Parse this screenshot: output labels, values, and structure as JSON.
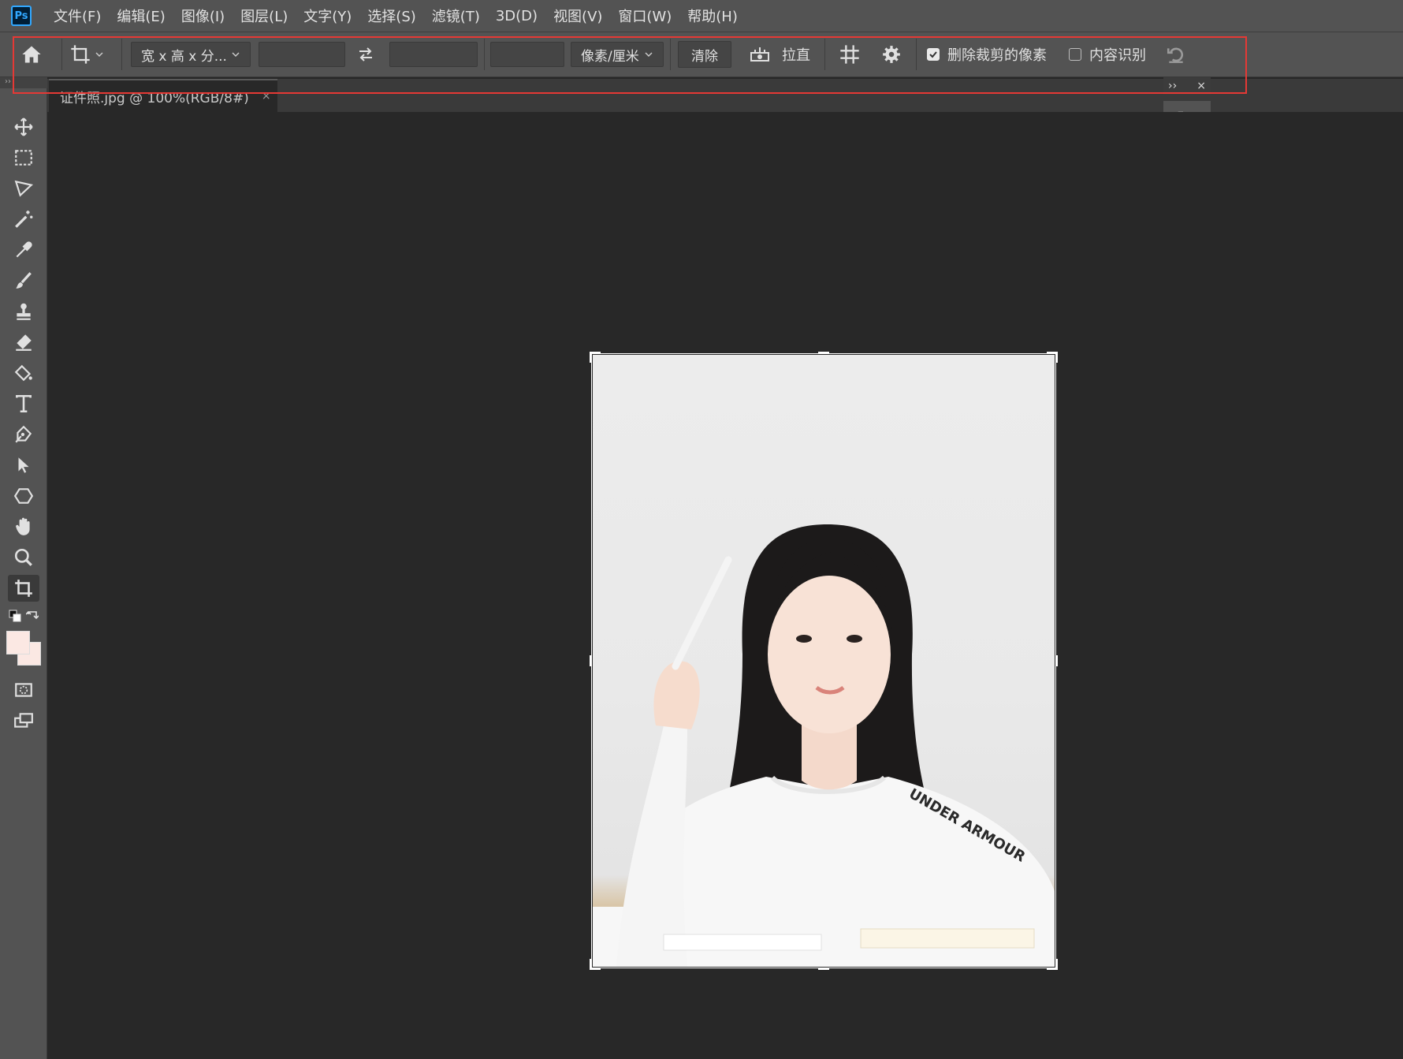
{
  "app": {
    "logo": "Ps"
  },
  "menu": [
    "文件(F)",
    "编辑(E)",
    "图像(I)",
    "图层(L)",
    "文字(Y)",
    "选择(S)",
    "滤镜(T)",
    "3D(D)",
    "视图(V)",
    "窗口(W)",
    "帮助(H)"
  ],
  "options": {
    "ratio_preset": "宽 x 高 x 分...",
    "width_value": "",
    "height_value": "",
    "resolution_value": "",
    "unit": "像素/厘米",
    "clear_label": "清除",
    "straighten_label": "拉直",
    "delete_cropped_label": "删除裁剪的像素",
    "delete_cropped_checked": true,
    "content_aware_label": "内容识别",
    "content_aware_checked": false
  },
  "document_tab": {
    "title": "证件照.jpg @ 100%(RGB/8#)",
    "close": "×"
  },
  "panel": {
    "expand": "››",
    "close": "×"
  },
  "colors": {
    "foreground": "#fbe8e3",
    "background": "#fbe8e3",
    "highlight": "#e53935"
  },
  "photo": {
    "shirt_text": "UNDER ARMOUR"
  },
  "icons": [
    "home-icon",
    "crop-tool-icon",
    "swap-icon",
    "straighten-icon",
    "grid-overlay-icon",
    "gear-icon",
    "reset-icon",
    "move-icon",
    "marquee-icon",
    "lasso-icon",
    "magic-wand-icon",
    "eyedropper-icon",
    "brush-icon",
    "stamp-icon",
    "eraser-icon",
    "paint-bucket-icon",
    "type-icon",
    "pen-icon",
    "path-select-icon",
    "shape-icon",
    "hand-icon",
    "zoom-icon",
    "crop-icon",
    "swap-colors-icon",
    "quick-mask-icon",
    "screen-mode-icon"
  ]
}
